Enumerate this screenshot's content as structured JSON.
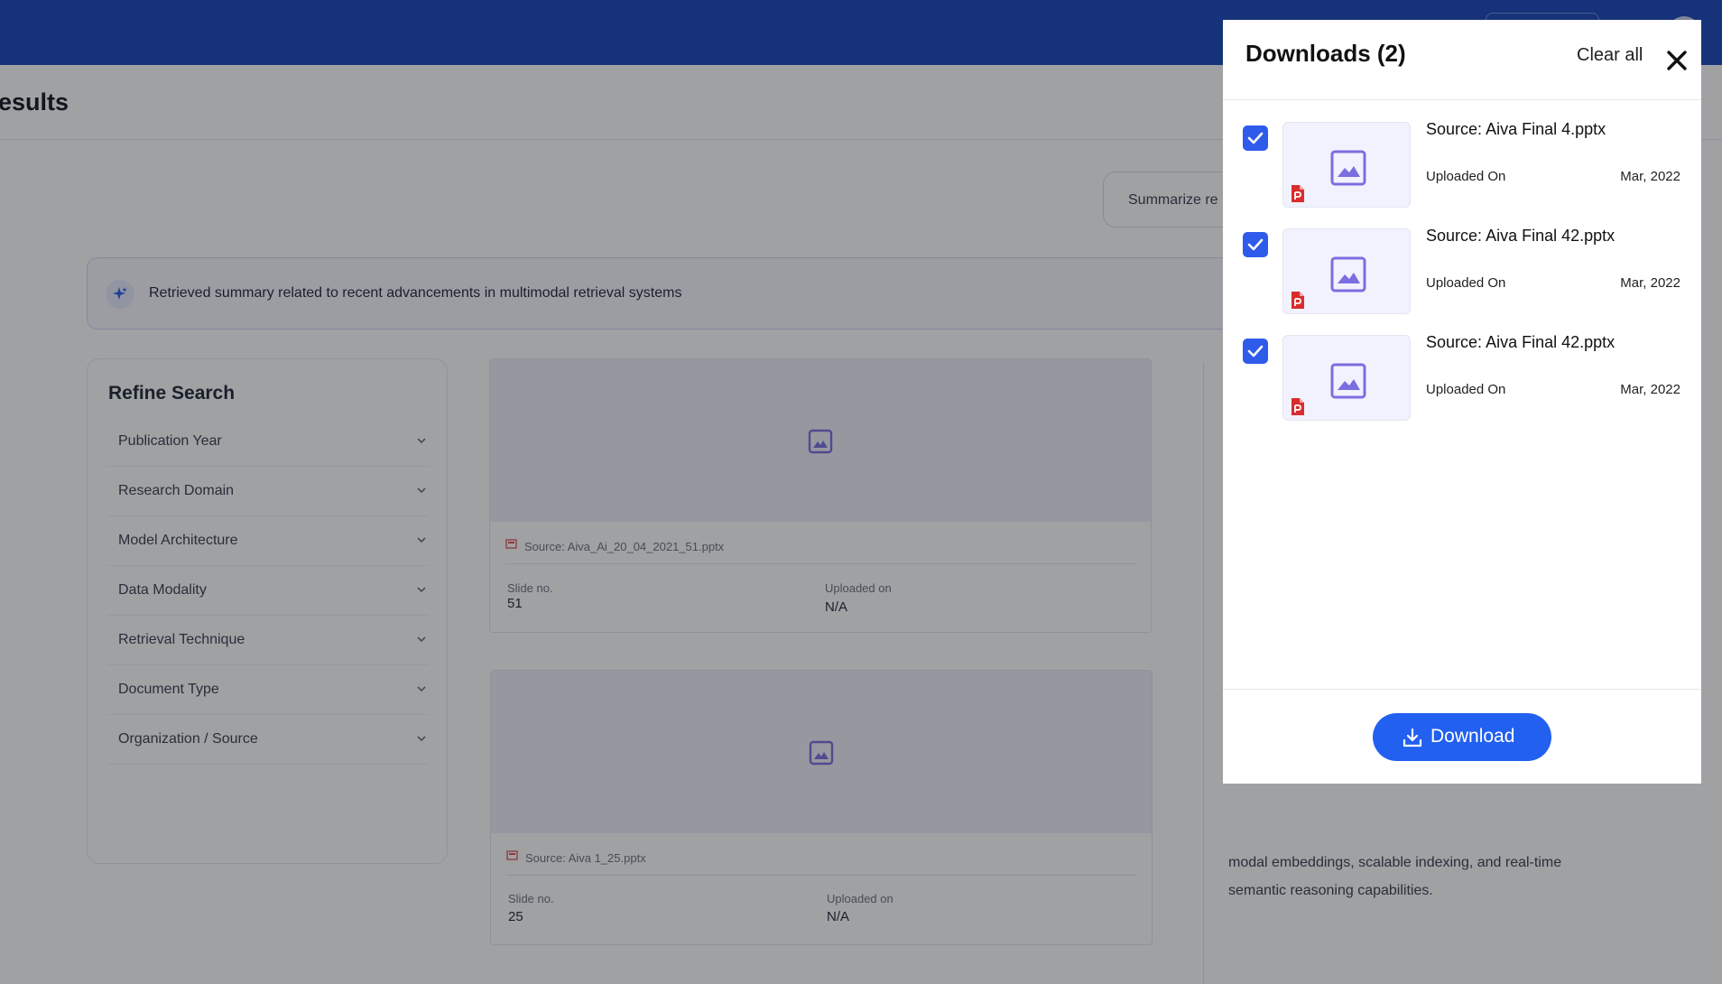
{
  "page": {
    "title": "esults",
    "summarize_label": "Summarize re",
    "summary_banner": "Retrieved summary related to recent advancements in multimodal retrieval systems"
  },
  "refine": {
    "title": "Refine Search",
    "filters": [
      {
        "label": "Publication Year"
      },
      {
        "label": "Research Domain"
      },
      {
        "label": "Model Architecture"
      },
      {
        "label": "Data Modality"
      },
      {
        "label": "Retrieval Technique"
      },
      {
        "label": "Document Type"
      },
      {
        "label": "Organization / Source"
      }
    ]
  },
  "results": [
    {
      "source": "Source: Aiva_Ai_20_04_2021_51.pptx",
      "slide_label": "Slide no.",
      "slide_value": "51",
      "uploaded_label": "Uploaded on",
      "uploaded_value": "N/A"
    },
    {
      "source": "Source: Aiva 1_25.pptx",
      "slide_label": "Slide no.",
      "slide_value": "25",
      "uploaded_label": "Uploaded on",
      "uploaded_value": "N/A"
    }
  ],
  "right_pane": {
    "text": "modal embeddings, scalable indexing, and real-time semantic reasoning capabilities."
  },
  "downloads": {
    "title": "Downloads (2)",
    "clear_label": "Clear all",
    "button_label": "Download",
    "items": [
      {
        "source_prefix": "Source:",
        "file": "Aiva Final 4.pptx",
        "uploaded_label": "Uploaded On",
        "uploaded_value": "Mar, 2022",
        "checked": true
      },
      {
        "source_prefix": "Source:",
        "file": "Aiva Final 42.pptx",
        "uploaded_label": "Uploaded On",
        "uploaded_value": "Mar, 2022",
        "checked": true
      },
      {
        "source_prefix": "Source:",
        "file": "Aiva Final 42.pptx",
        "uploaded_label": "Uploaded On",
        "uploaded_value": "Mar, 2022",
        "checked": true
      }
    ]
  },
  "colors": {
    "header": "#1a46b8",
    "accent": "#2260f0",
    "checkbox": "#2f5bea",
    "image_icon": "#7b6ee0",
    "ppt_icon": "#d92d2d"
  }
}
